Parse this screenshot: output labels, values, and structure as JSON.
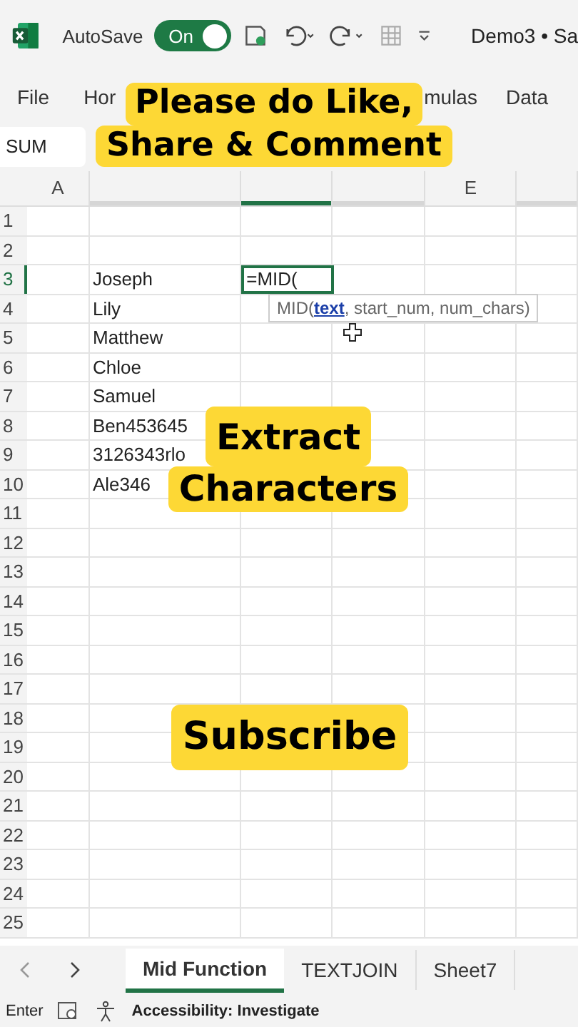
{
  "title_bar": {
    "autosave_label": "AutoSave",
    "autosave": {
      "on": true,
      "label": "On"
    },
    "document_title": "Demo3 • Sa"
  },
  "ribbon_tabs": [
    {
      "label": "File"
    },
    {
      "label": "Hor"
    },
    {
      "label": "mulas"
    },
    {
      "label": "Data"
    }
  ],
  "formula_bar": {
    "name_box": "SUM"
  },
  "columns": [
    {
      "label": "A",
      "selected": false
    },
    {
      "selected": false
    },
    {
      "selected": true
    },
    {
      "selected": false
    },
    {
      "label": "E",
      "selected": false
    },
    {
      "selected": false
    }
  ],
  "rows": [
    {
      "number": "1",
      "selected": false
    },
    {
      "number": "2",
      "selected": false
    },
    {
      "number": "3",
      "selected": true,
      "b": "Joseph",
      "c": "=MID("
    },
    {
      "number": "4",
      "selected": false,
      "b": "Lily"
    },
    {
      "number": "5",
      "selected": false,
      "b": "Matthew"
    },
    {
      "number": "6",
      "selected": false,
      "b": "Chloe"
    },
    {
      "number": "7",
      "selected": false,
      "b": "Samuel"
    },
    {
      "number": "8",
      "selected": false,
      "b": "Ben453645"
    },
    {
      "number": "9",
      "selected": false,
      "b": "3126343rlo"
    },
    {
      "number": "10",
      "selected": false,
      "b": "Ale346"
    },
    {
      "number": "11",
      "selected": false
    },
    {
      "number": "12",
      "selected": false
    },
    {
      "number": "13",
      "selected": false
    },
    {
      "number": "14",
      "selected": false
    },
    {
      "number": "15",
      "selected": false
    },
    {
      "number": "16",
      "selected": false
    },
    {
      "number": "17",
      "selected": false
    },
    {
      "number": "18",
      "selected": false
    },
    {
      "number": "19",
      "selected": false
    },
    {
      "number": "20",
      "selected": false
    },
    {
      "number": "21",
      "selected": false
    },
    {
      "number": "22",
      "selected": false
    },
    {
      "number": "23",
      "selected": false
    },
    {
      "number": "24",
      "selected": false
    },
    {
      "number": "25",
      "selected": false
    }
  ],
  "tooltip": {
    "function": "MID(",
    "current_argument": "text",
    "rest": ", start_num, num_chars)"
  },
  "sheet_tabs": [
    {
      "label": "Mid Function",
      "selected": true
    },
    {
      "label": "TEXTJOIN",
      "selected": false
    },
    {
      "label": "Sheet7",
      "selected": false
    }
  ],
  "status_bar": {
    "mode": "Enter",
    "accessibility": "Accessibility: Investigate"
  },
  "captions": [
    {
      "lines": [
        "Please do Like,",
        "Share & Comment"
      ]
    },
    {
      "lines": [
        "Extract",
        "Characters"
      ]
    },
    {
      "lines": [
        "Subscribe"
      ]
    }
  ]
}
